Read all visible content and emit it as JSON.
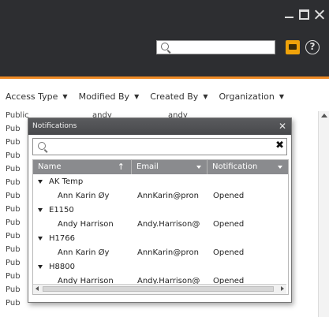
{
  "colors": {
    "titlebar": "#2d2e31",
    "accent": "#ee8a25",
    "dialog_header": "#8a8b8e",
    "search_folder": "#f0a30a"
  },
  "toolbar": {
    "search_placeholder": "",
    "help_label": "?"
  },
  "columns": [
    {
      "label": "Access Type"
    },
    {
      "label": "Modified By"
    },
    {
      "label": "Created By"
    },
    {
      "label": "Organization"
    }
  ],
  "background_rows": [
    [
      "Public",
      "andy",
      "andy"
    ],
    [
      "Pub",
      "",
      ""
    ],
    [
      "Pub",
      "",
      ""
    ],
    [
      "Pub",
      "",
      ""
    ],
    [
      "Pub",
      "",
      ""
    ],
    [
      "Pub",
      "",
      ""
    ],
    [
      "Pub",
      "",
      ""
    ],
    [
      "Pub",
      "",
      ""
    ],
    [
      "Pub",
      "",
      ""
    ],
    [
      "Pub",
      "",
      ""
    ],
    [
      "Pub",
      "",
      ""
    ],
    [
      "Pub",
      "",
      ""
    ],
    [
      "Pub",
      "",
      ""
    ],
    [
      "Pub",
      "",
      ""
    ],
    [
      "Pub",
      "",
      ""
    ]
  ],
  "dialog": {
    "title": "Notifications",
    "search_placeholder": "",
    "headers": {
      "name": "Name",
      "email": "Email",
      "notification": "Notification"
    },
    "groups": [
      {
        "label": "AK Temp",
        "row": {
          "name": "Ann Karin Øy",
          "email": "AnnKarin@pron",
          "status": "Opened"
        }
      },
      {
        "label": "E1150",
        "row": {
          "name": "Andy Harrison",
          "email": "Andy.Harrison@",
          "status": "Opened"
        }
      },
      {
        "label": "H1766",
        "row": {
          "name": "Ann Karin Øy",
          "email": "AnnKarin@pron",
          "status": "Opened"
        }
      },
      {
        "label": "H8800",
        "row": {
          "name": "Andy Harrison",
          "email": "Andy.Harrison@",
          "status": "Opened"
        }
      }
    ]
  }
}
